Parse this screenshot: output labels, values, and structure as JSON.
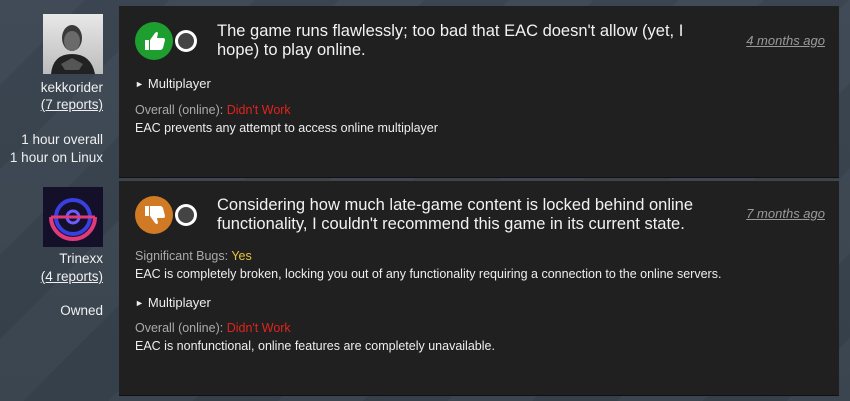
{
  "reports": [
    {
      "user": {
        "name": "kekkorider",
        "reports_link": "(7 reports)",
        "playtime_overall": "1 hour overall",
        "playtime_linux": "1 hour on Linux"
      },
      "rating": "thumbs-up",
      "summary": "The game runs flawlessly; too bad that EAC doesn't allow (yet, I hope) to play online.",
      "date": "4 months ago",
      "multiplayer_toggle": "Multiplayer",
      "overall_online_label": "Overall (online): ",
      "overall_online_value": "Didn't Work",
      "overall_online_note": "EAC prevents any attempt to access online multiplayer"
    },
    {
      "user": {
        "name": "Trinexx",
        "reports_link": "(4 reports)",
        "ownership": "Owned"
      },
      "rating": "thumbs-down",
      "summary": "Considering how much late-game content is locked behind online functionality, I couldn't recommend this game in its current state.",
      "date": "7 months ago",
      "bugs_label": "Significant Bugs: ",
      "bugs_value": "Yes",
      "bugs_note": "EAC is completely broken, locking you out of any functionality requiring a connection to the online servers.",
      "multiplayer_toggle": "Multiplayer",
      "overall_online_label": "Overall (online): ",
      "overall_online_value": "Didn't Work",
      "overall_online_note": "EAC is nonfunctional, online features are completely unavailable."
    }
  ],
  "colors": {
    "thumbs_up": "#1e9e2e",
    "thumbs_down": "#d07a25",
    "didnt_work": "#e0241c",
    "bugs_yes": "#e8c43c"
  }
}
